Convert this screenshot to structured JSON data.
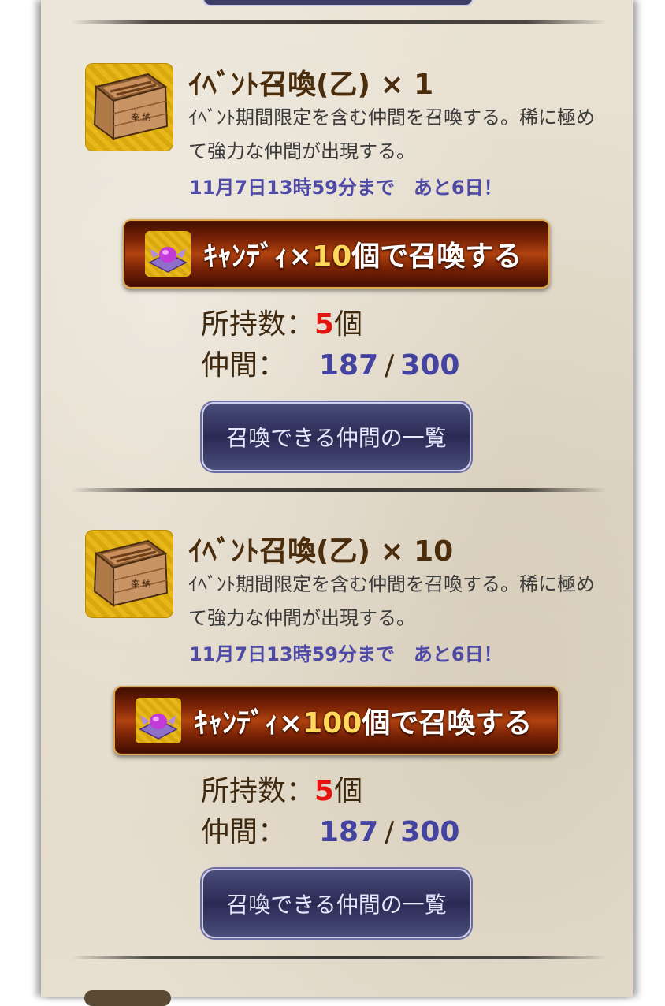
{
  "sections": [
    {
      "title": "ｲﾍﾞﾝﾄ召喚(乙) × 1",
      "description": "ｲﾍﾞﾝﾄ期間限定を含む仲間を召喚する。稀に極めて強力な仲間が出現する。",
      "deadline": "11月7日13時59分まで　あと6日！",
      "cost_prefix": "ｷｬﾝﾃﾞｨ×",
      "cost_count": "10",
      "cost_suffix": "個で召喚する",
      "owned_label": "所持数：",
      "owned_value": "5",
      "owned_unit": "個",
      "party_label": "仲間：",
      "party_current": "187",
      "party_sep": "/",
      "party_max": "300",
      "list_button": "召喚できる仲間の一覧"
    },
    {
      "title": "ｲﾍﾞﾝﾄ召喚(乙) × 10",
      "description": "ｲﾍﾞﾝﾄ期間限定を含む仲間を召喚する。稀に極めて強力な仲間が出現する。",
      "deadline": "11月7日13時59分まで　あと6日！",
      "cost_prefix": "ｷｬﾝﾃﾞｨ×",
      "cost_count": "100",
      "cost_suffix": "個で召喚する",
      "owned_label": "所持数：",
      "owned_value": "5",
      "owned_unit": "個",
      "party_label": "仲間：",
      "party_current": "187",
      "party_sep": "/",
      "party_max": "300",
      "list_button": "召喚できる仲間の一覧"
    }
  ],
  "icons": {
    "summon_item": "crate-icon",
    "currency": "candy-icon"
  },
  "colors": {
    "title": "#4b2d0c",
    "deadline": "#4e4aa6",
    "owned_value": "#e4140f",
    "party_value": "#4543a1",
    "cost_count": "#ffd75a"
  }
}
